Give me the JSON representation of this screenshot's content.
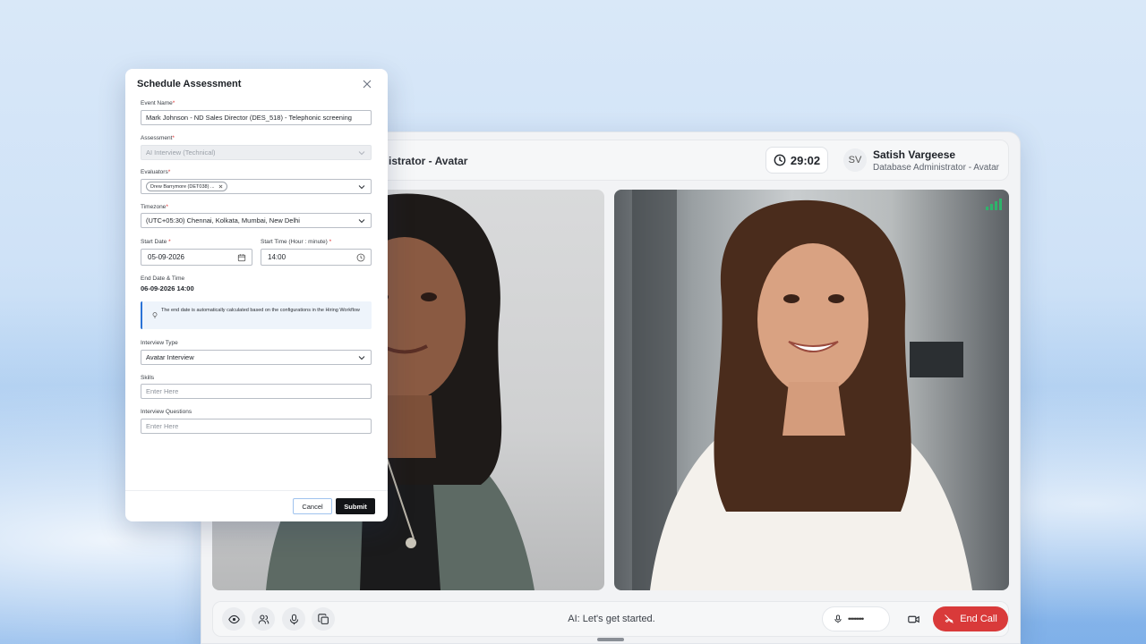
{
  "call": {
    "title": "istrator - Avatar",
    "timer": "29:02",
    "avatar_initials": "SV",
    "user_name": "Satish Vargeese",
    "user_role": "Database Administrator - Avatar",
    "caption": "AI: Let's get started.",
    "mic_level": "••••••••",
    "end_call_label": "End Call",
    "colors": {
      "end_call": "#d93a3a",
      "signal": "#2fb36b"
    }
  },
  "dialog": {
    "title": "Schedule Assessment",
    "event_name": {
      "label": "Event Name",
      "value": "Mark Johnson - ND Sales Director (DES_518) - Telephonic screening"
    },
    "assessment": {
      "label": "Assessment",
      "value": "AI Interview (Technical)"
    },
    "evaluators": {
      "label": "Evaluators",
      "chip": "Drew Barrymore (DET038) ..."
    },
    "timezone": {
      "label": "Timezone",
      "value": "(UTC+05:30) Chennai, Kolkata, Mumbai, New Delhi"
    },
    "start_date": {
      "label": "Start Date",
      "value": "05-09-2026"
    },
    "start_time": {
      "label": "Start Time (Hour : minute)",
      "value": "14:00"
    },
    "end_date": {
      "label": "End Date & Time",
      "value": "06-09-2026 14:00"
    },
    "info": "The end date is automatically calculated based on the configurations in the Hiring Workflow",
    "interview_type": {
      "label": "Interview Type",
      "value": "Avatar Interview"
    },
    "skills": {
      "label": "Skills",
      "placeholder": "Enter Here"
    },
    "questions": {
      "label": "Interview Questions",
      "placeholder": "Enter Here"
    },
    "required_mark": "*",
    "cancel_label": "Cancel",
    "submit_label": "Submit"
  }
}
